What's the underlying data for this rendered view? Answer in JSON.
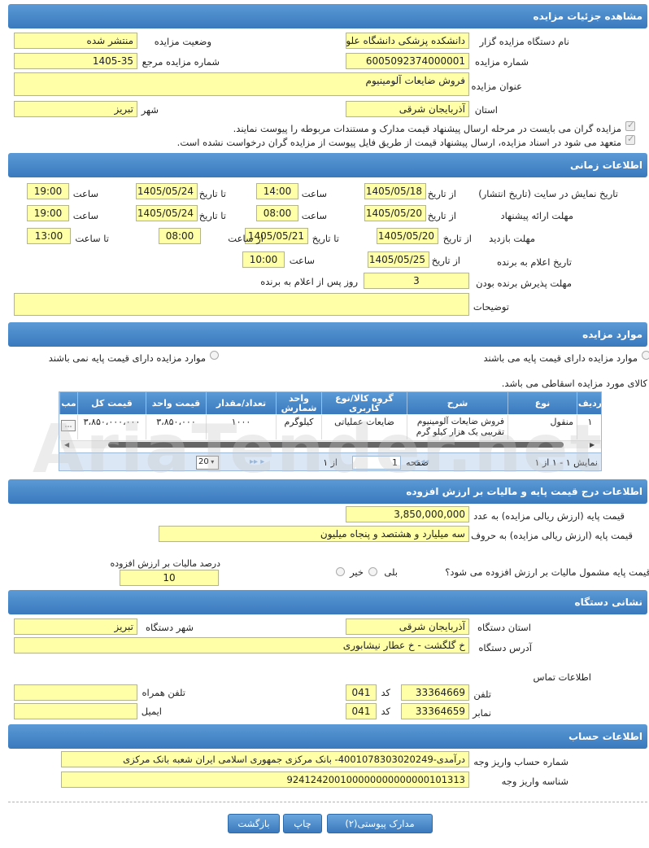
{
  "sec": {
    "details": "مشاهده جزئیات مزایده",
    "time": "اطلاعات زمانی",
    "items": "موارد مزایده",
    "price": "اطلاعات درج قیمت پایه و مالیات بر ارزش افزوده",
    "addr": "نشانی دستگاه",
    "account": "اطلاعات حساب"
  },
  "details": {
    "org_label": "نام دستگاه مزایده گزار",
    "org_value": "دانشکده پزشکی دانشگاه علوم پزشکی",
    "status_label": "وضعیت مزایده",
    "status_value": "منتشر شده",
    "num_label": "شماره مزایده",
    "num_value": "6005092374000001",
    "ref_label": "شماره مزایده مرجع",
    "ref_value": "1405-35",
    "title_label": "عنوان مزایده",
    "title_value": "فروش ضایعات آلومینیوم",
    "province_label": "استان",
    "province_value": "آذربایجان شرقی",
    "city_label": "شهر",
    "city_value": "تبریز",
    "cb1": "مزایده گران می بایست در مرحله ارسال پیشنهاد قیمت مدارک و مستندات مربوطه را پیوست نمایند.",
    "cb2": "متعهد می شود در اسناد مزایده، ارسال پیشنهاد قیمت از طریق فایل پیوست از مزایده گران درخواست نشده است."
  },
  "time": {
    "r1_label": "تاریخ نمایش در سایت (تاریخ انتشار)",
    "r1_from": "1405/05/18",
    "r1_from_time": "14:00",
    "r1_to": "1405/05/24",
    "r1_to_time": "19:00",
    "r2_label": "مهلت ارائه پیشنهاد",
    "r2_from": "1405/05/20",
    "r2_from_time": "08:00",
    "r2_to": "1405/05/24",
    "r2_to_time": "19:00",
    "r3_label": "مهلت بازدید",
    "r3_from": "1405/05/20",
    "r3_to": "1405/05/21",
    "r3_from_time": "08:00",
    "r3_to_time": "13:00",
    "r4_label": "تاریخ اعلام به برنده",
    "r4_from": "1405/05/25",
    "r4_time": "10:00",
    "r5_label": "مهلت پذیرش برنده بودن",
    "r5_value": "3",
    "r5_suffix": "روز پس از اعلام به برنده",
    "desc_label": "توضیحات",
    "from_date": "از تاریخ",
    "to_date": "تا تاریخ",
    "hour": "ساعت",
    "from_hour": "از ساعت",
    "to_hour": "تا ساعت"
  },
  "items": {
    "opt_with": "موارد مزایده دارای قیمت پایه می باشند",
    "opt_without": "موارد مزایده دارای قیمت پایه نمی باشند",
    "note": "کالای مورد مزایده اسقاطی می باشد.",
    "cols": [
      "ردیف",
      "نوع",
      "شرح",
      "گروه کالا/نوع کاربری",
      "واحد شمارش",
      "تعداد/مقدار",
      "قیمت واحد",
      "قیمت کل",
      "مب"
    ],
    "row": [
      "۱",
      "منقول",
      "فروش ضایعات آلومینیوم تقریبی یک هزار کیلو گرم",
      "ضایعات عملیاتی",
      "کیلوگرم",
      "۱۰۰۰",
      "۳،۸۵۰،۰۰۰",
      "۳،۸۵۰،۰۰۰،۰۰۰",
      ""
    ],
    "pager_show": "نمایش ۱ - ۱ از ۱",
    "pager_page": "صفحه",
    "pager_page_val": "1",
    "pager_of": "از ۱",
    "pager_size": "20"
  },
  "price": {
    "num_label": "قیمت پایه (ارزش ریالی مزایده) به عدد",
    "num_value": "3,850,000,000",
    "word_label": "قیمت پایه (ارزش ریالی مزایده) به حروف",
    "word_value": "سه میلیارد و هشتصد و پنجاه میلیون",
    "vat_q": "قیمت پایه مشمول مالیات بر ارزش افزوده می شود؟",
    "yes": "بلی",
    "no": "خیر",
    "vat_label": "درصد مالیات بر ارزش افزوده",
    "vat_value": "10"
  },
  "addr": {
    "province_label": "استان دستگاه",
    "province_value": "آذربایجان شرقی",
    "city_label": "شهر دستگاه",
    "city_value": "تبریز",
    "addr_label": "آدرس دستگاه",
    "addr_value": "خ گلگشت - خ عطار نیشابوری",
    "contact": "اطلاعات تماس",
    "tel_label": "تلفن",
    "tel_code": "041",
    "tel_value": "33364669",
    "code_label": "کد",
    "fax_label": "نمابر",
    "fax_code": "041",
    "fax_value": "33364659",
    "mobile_label": "تلفن همراه",
    "email_label": "ایمیل"
  },
  "account": {
    "acc_label": "شماره حساب واریز وجه",
    "acc_value": "درآمدی-4001078303020249- بانک مرکزی جمهوری اسلامی ایران شعبه بانک مرکزی",
    "shaba_label": "شناسه واریز وجه",
    "shaba_value": "924124200100000000000000101313"
  },
  "buttons": {
    "docs": "مدارک پیوستی(۲)",
    "print": "چاپ",
    "back": "بازگشت"
  },
  "watermark": "AriaTender.net"
}
